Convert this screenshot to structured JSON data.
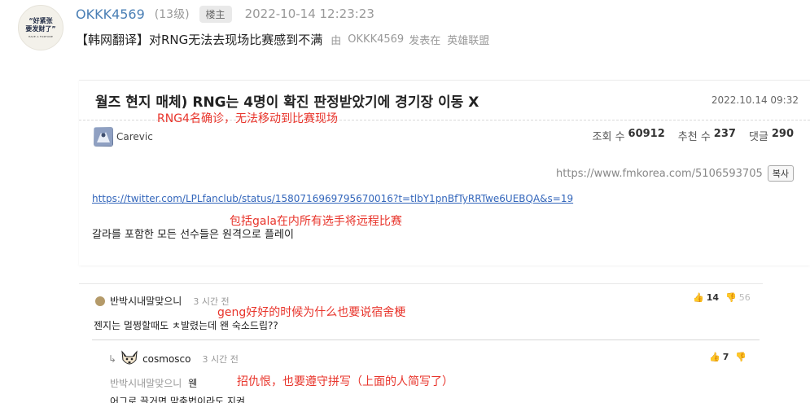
{
  "post": {
    "avatar_line1": "“好紧张",
    "avatar_line2": "要发财了”",
    "avatar_line3": "HAVE A FORTUNE",
    "author": "OKKK4569",
    "level": "(13级)",
    "op_badge": "楼主",
    "time": "2022-10-14 12:23:23",
    "title": "【韩网翻译】对RNG无法去现场比赛感到不满",
    "by": "由",
    "by_author": "OKKK4569",
    "posted_in": "发表在",
    "forum": "英雄联盟"
  },
  "card": {
    "title": "월즈 현지 매체) RNG는 4명이 확진 판정받았기에 경기장 이동 X",
    "date": "2022.10.14 09:32",
    "poster": "Carevic",
    "views_label": "조회 수",
    "views": "60912",
    "recs_label": "추천 수",
    "recs": "237",
    "comments_label": "댓글",
    "comments": "290",
    "source_url": "https://www.fmkorea.com/5106593705",
    "copy_label": "복사",
    "tweet_url": "https://twitter.com/LPLfanclub/status/1580716969795670016?t=tlbY1pnBfTyRRTwe6UEBQA&s=19",
    "body": "갈라를 포함한 모든 선수들은 원격으로 플레이"
  },
  "annotations": {
    "a1": "RNG4名确诊，无法移动到比赛现场",
    "a2": "包括gala在内所有选手将远程比赛",
    "a3": "geng好好的时候为什么也要说宿舍梗",
    "a4": "招仇恨，也要遵守拼写（上面的人简写了）"
  },
  "comment1": {
    "user": "반박시내말맞으니",
    "time": "3 시간 전",
    "body": "젠지는 멀쩡할때도 ㅊ발렸는데 왠 숙소드립??",
    "up": "14",
    "down": "56"
  },
  "reply1": {
    "arrow": "↳",
    "user": "cosmosco",
    "time": "3 시간 전",
    "up": "7",
    "quote_user": "반박시내말맞으니",
    "quote_text": "웬",
    "body": "어그로 끌거면 맞춤법이라도 지켜"
  },
  "colors": {
    "link": "#3366bb",
    "author": "#4a7fb5",
    "annotation": "#e8342b"
  }
}
